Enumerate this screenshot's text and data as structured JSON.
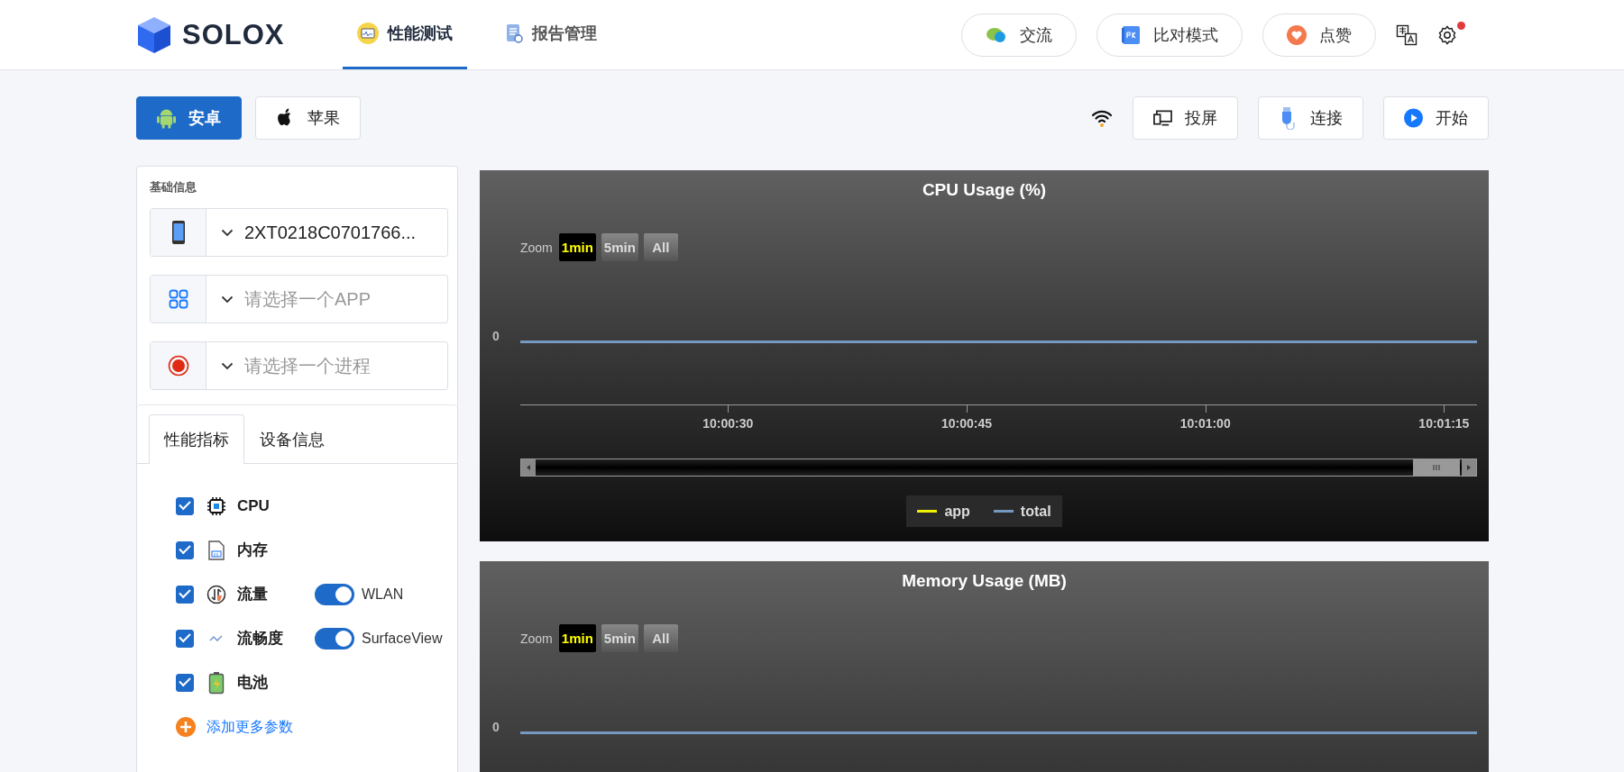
{
  "header": {
    "logo": "SOLOX",
    "nav": [
      {
        "label": "性能测试",
        "selected": true
      },
      {
        "label": "报告管理",
        "selected": false
      }
    ],
    "actions": [
      "交流",
      "比对模式",
      "点赞"
    ]
  },
  "platforms": [
    {
      "label": "安卓",
      "selected": true
    },
    {
      "label": "苹果",
      "selected": false
    }
  ],
  "toolbar": [
    "投屏",
    "连接",
    "开始"
  ],
  "basic_info": {
    "title": "基础信息",
    "selects": [
      {
        "value": "2XT0218C0701766..."
      },
      {
        "placeholder": "请选择一个APP"
      },
      {
        "placeholder": "请选择一个进程"
      }
    ]
  },
  "metric_tabs": [
    {
      "label": "性能指标",
      "selected": true
    },
    {
      "label": "设备信息",
      "selected": false
    }
  ],
  "metrics": [
    {
      "label": "CPU",
      "checked": true
    },
    {
      "label": "内存",
      "checked": true
    },
    {
      "label": "流量",
      "checked": true,
      "toggle": {
        "label": "WLAN",
        "on": true
      }
    },
    {
      "label": "流畅度",
      "checked": true,
      "toggle": {
        "label": "SurfaceView",
        "on": true
      }
    },
    {
      "label": "电池",
      "checked": true
    }
  ],
  "add_more": "添加更多参数",
  "charts": [
    {
      "title": "CPU Usage (%)",
      "zoom_label": "Zoom",
      "zoom_buttons": [
        {
          "label": "1min",
          "selected": true
        },
        {
          "label": "5min",
          "selected": false
        },
        {
          "label": "All",
          "selected": false
        }
      ],
      "y_label": "0",
      "x_labels": [
        "10:00:30",
        "10:00:45",
        "10:01:00",
        "10:01:15"
      ],
      "legend": [
        {
          "name": "app",
          "color": "#f0f000"
        },
        {
          "name": "total",
          "color": "#7798bf"
        }
      ]
    },
    {
      "title": "Memory Usage (MB)",
      "zoom_label": "Zoom",
      "zoom_buttons": [
        {
          "label": "1min",
          "selected": true
        },
        {
          "label": "5min",
          "selected": false
        },
        {
          "label": "All",
          "selected": false
        }
      ],
      "y_label": "0"
    }
  ]
}
